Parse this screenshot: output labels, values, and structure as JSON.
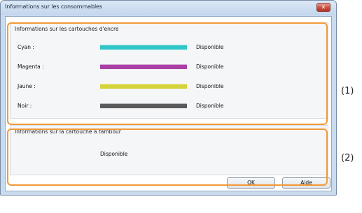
{
  "window": {
    "title": "Informations sur les consommables",
    "close_glyph": "✕"
  },
  "ink_group": {
    "title": "Informations sur les cartouches d'encre",
    "rows": [
      {
        "label": "Cyan :",
        "status": "Disponible",
        "color": "#2fc6c8"
      },
      {
        "label": "Magenta :",
        "status": "Disponible",
        "color": "#a93fa6"
      },
      {
        "label": "Jaune :",
        "status": "Disponible",
        "color": "#d4d43a"
      },
      {
        "label": "Noir :",
        "status": "Disponible",
        "color": "#5a5a5a"
      }
    ]
  },
  "drum_group": {
    "title": "Informations sur la cartouche à tambour",
    "status": "Disponible"
  },
  "callouts": {
    "label_1": "(1)",
    "label_2": "(2)",
    "color": "#f29a38"
  },
  "buttons": {
    "ok": "OK",
    "help": "Aide"
  }
}
